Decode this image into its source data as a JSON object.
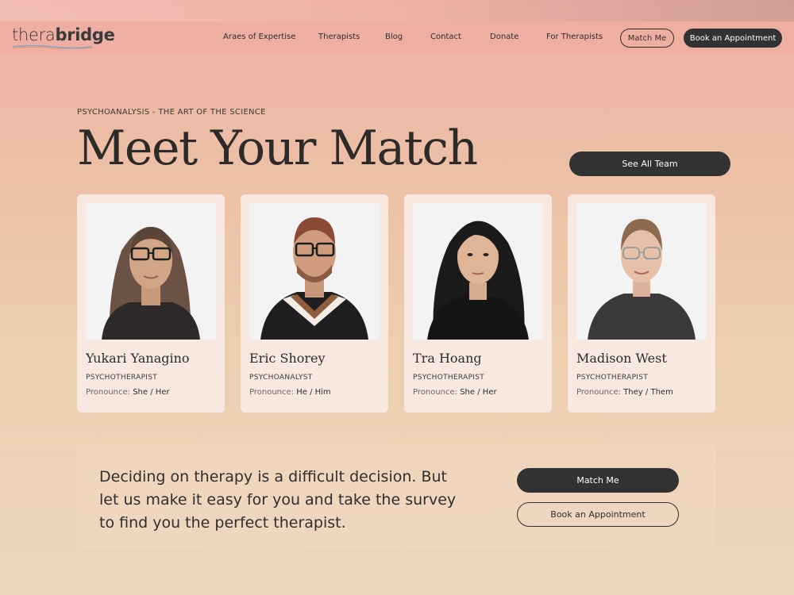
{
  "brand": {
    "logo_light": "thera",
    "logo_bold": "bridge"
  },
  "nav": {
    "items": [
      "Araes of Expertise",
      "Therapists",
      "Blog",
      "Contact",
      "Donate",
      "For Therapists"
    ],
    "match_me": "Match Me",
    "book": "Book an Appointment"
  },
  "hero": {
    "eyebrow": "PSYCHOANALYSIS - THE ART OF THE SCIENCE",
    "title": "Meet Your Match",
    "see_all": "See All Team"
  },
  "therapists": [
    {
      "name": "Yukari Yanagino",
      "role": "PSYCHOTHERAPIST",
      "pronoun_label": "Pronounce:",
      "pronoun_1": "She",
      "pronoun_sep": "/",
      "pronoun_2": "Her"
    },
    {
      "name": "Eric Shorey",
      "role": "PSYCHOANALYST",
      "pronoun_label": "Pronounce:",
      "pronoun_1": "He",
      "pronoun_sep": "/",
      "pronoun_2": "Him"
    },
    {
      "name": "Tra Hoang",
      "role": "PSYCHOTHERAPIST",
      "pronoun_label": "Pronounce:",
      "pronoun_1": "She",
      "pronoun_sep": "/",
      "pronoun_2": "Her"
    },
    {
      "name": "Madison West",
      "role": "PSYCHOTHERAPIST",
      "pronoun_label": "Pronounce:",
      "pronoun_1": "They",
      "pronoun_sep": "/",
      "pronoun_2": "Them"
    }
  ],
  "cta": {
    "text": "Deciding on therapy is a difficult decision. But let us make it easy for you and take the survey to find you the perfect therapist.",
    "match_me": "Match Me",
    "book": "Book an Appointment"
  },
  "colors": {
    "dark_button": "#333232",
    "card_bg": "#f8e9e0",
    "cta_bg": "#f0d6be"
  }
}
